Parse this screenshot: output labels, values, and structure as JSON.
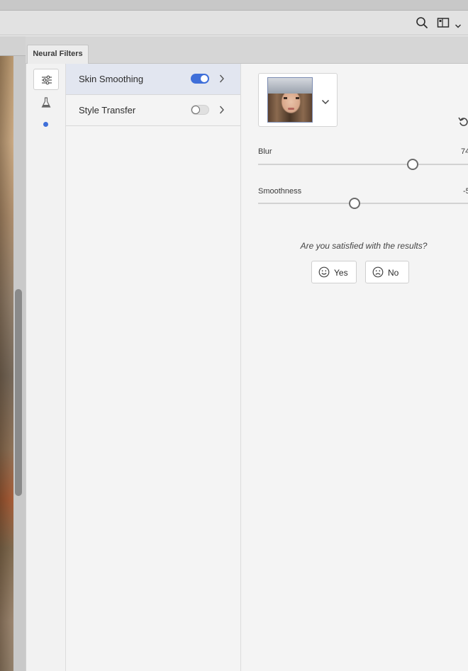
{
  "panel": {
    "tab_label": "Neural Filters"
  },
  "toolbar": {
    "icons": [
      "search-icon",
      "workspace-icon",
      "chevron-down-icon"
    ]
  },
  "rail": {
    "icons": [
      "sliders-icon",
      "beaker-icon",
      "dot-icon"
    ]
  },
  "filters": [
    {
      "label": "Skin Smoothing",
      "enabled": true
    },
    {
      "label": "Style Transfer",
      "enabled": false
    }
  ],
  "settings": {
    "sliders": [
      {
        "label": "Blur",
        "value": 0.735,
        "display": "74"
      },
      {
        "label": "Smoothness",
        "value": 0.46,
        "display": "-5"
      }
    ],
    "feedback": {
      "question": "Are you satisfied with the results?",
      "yes_label": "Yes",
      "no_label": "No"
    }
  },
  "colors": {
    "accent": "#3f6fd9",
    "active_row": "#e2e6f0"
  }
}
